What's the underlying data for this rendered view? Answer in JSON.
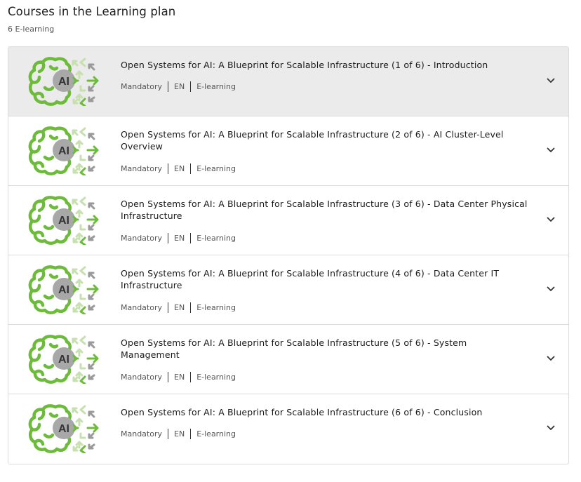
{
  "header": {
    "title": "Courses in the Learning plan",
    "count": "6 E-learning"
  },
  "thumbnail": {
    "badge": "AI"
  },
  "courses": [
    {
      "title": "Open Systems for AI: A Blueprint for Scalable Infrastructure (1 of 6) - Introduction",
      "status": "Mandatory",
      "language": "EN",
      "type": "E-learning",
      "expanded": false
    },
    {
      "title": "Open Systems for AI: A Blueprint for Scalable Infrastructure (2 of 6) - AI Cluster-Level Overview",
      "status": "Mandatory",
      "language": "EN",
      "type": "E-learning",
      "expanded": false
    },
    {
      "title": "Open Systems for AI: A Blueprint for Scalable Infrastructure (3 of 6) - Data Center Physical Infrastructure",
      "status": "Mandatory",
      "language": "EN",
      "type": "E-learning",
      "expanded": false
    },
    {
      "title": "Open Systems for AI: A Blueprint for Scalable Infrastructure (4 of 6) - Data Center IT Infrastructure",
      "status": "Mandatory",
      "language": "EN",
      "type": "E-learning",
      "expanded": false
    },
    {
      "title": "Open Systems for AI: A Blueprint for Scalable Infrastructure (5 of 6) - System Management",
      "status": "Mandatory",
      "language": "EN",
      "type": "E-learning",
      "expanded": false
    },
    {
      "title": "Open Systems for AI: A Blueprint for Scalable Infrastructure (6 of 6) - Conclusion",
      "status": "Mandatory",
      "language": "EN",
      "type": "E-learning",
      "expanded": false
    }
  ],
  "colors": {
    "brain_green": "#6dbb3a",
    "arrow_light": "#c6e0b0",
    "arrow_gray": "#9a9a9a",
    "badge_gray": "#a8a8a8",
    "selected_row_bg": "#ebebeb"
  }
}
